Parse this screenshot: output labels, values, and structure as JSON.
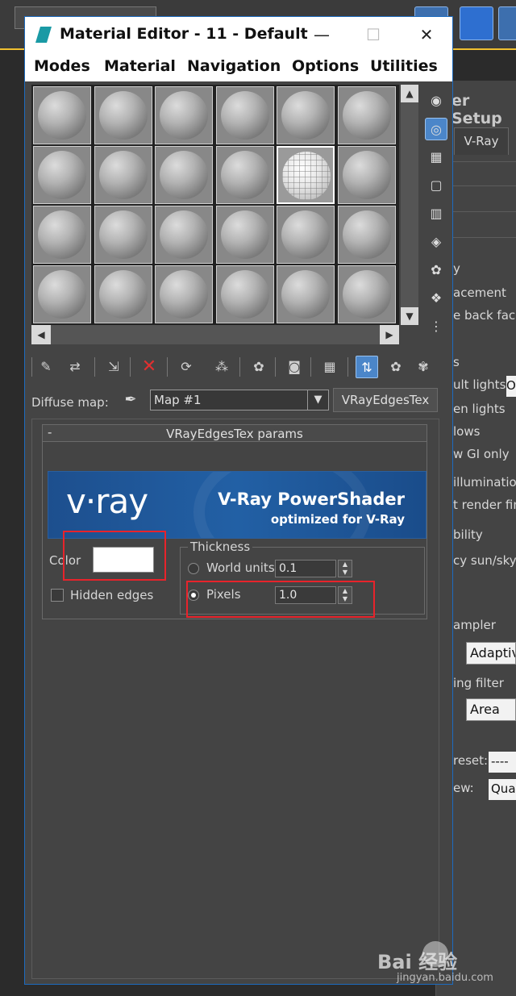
{
  "window": {
    "title": "Material Editor - 11 - Default",
    "controls": {
      "minimize": "—",
      "maximize": "☐",
      "close": "✕"
    }
  },
  "menu": [
    "Modes",
    "Material",
    "Navigation",
    "Options",
    "Utilities"
  ],
  "sample_slots": {
    "rows": 4,
    "cols": 6,
    "selected": {
      "row": 1,
      "col": 4
    }
  },
  "side_toolbar": [
    {
      "icon": "sample-type-icon",
      "glyph": "◉",
      "active": false
    },
    {
      "icon": "backlight-icon",
      "glyph": "◎",
      "active": true
    },
    {
      "icon": "background-checker-icon",
      "glyph": "▦",
      "active": false
    },
    {
      "icon": "sample-uv-tiling-icon",
      "glyph": "▢",
      "active": false
    },
    {
      "icon": "video-color-check-icon",
      "glyph": "▥",
      "active": false
    },
    {
      "icon": "make-preview-icon",
      "glyph": "◈",
      "active": false
    },
    {
      "icon": "material-options-icon",
      "glyph": "✿",
      "active": false
    },
    {
      "icon": "select-by-material-icon",
      "glyph": "❖",
      "active": false
    },
    {
      "icon": "material-map-navigator-icon",
      "glyph": "⋮",
      "active": false
    }
  ],
  "toolbar": [
    {
      "icon": "get-material-icon",
      "glyph": "✎"
    },
    {
      "icon": "put-material-icon",
      "glyph": "⇄"
    },
    {
      "icon": "assign-material-icon",
      "glyph": "⇲"
    },
    {
      "icon": "reset-map-icon",
      "glyph": "✕"
    },
    {
      "icon": "copy-material-icon",
      "glyph": "⟳"
    },
    {
      "icon": "make-unique-icon",
      "glyph": "⁂"
    },
    {
      "icon": "put-to-library-icon",
      "glyph": "✿"
    },
    {
      "icon": "material-id-channel-icon",
      "glyph": "◙"
    },
    {
      "icon": "show-shaded-material-icon",
      "glyph": "▦"
    },
    {
      "icon": "show-end-result-icon",
      "glyph": "⇅"
    },
    {
      "icon": "go-to-parent-icon",
      "glyph": "✿"
    },
    {
      "icon": "go-forward-to-sibling-icon",
      "glyph": "✾"
    }
  ],
  "map_row": {
    "label": "Diffuse map:",
    "map_name": "Map #1",
    "map_type": "VRayEdgesTex"
  },
  "rollout": {
    "toggle": "-",
    "title": "VRayEdgesTex params",
    "banner": {
      "logo": "v·ray",
      "headline": "V-Ray PowerShader",
      "sub": "optimized for V-Ray"
    },
    "color_label": "Color",
    "color_value": "#ffffff",
    "hidden_edges_label": "Hidden edges",
    "hidden_edges_checked": false,
    "thickness": {
      "title": "Thickness",
      "world_units_label": "World units",
      "world_units_value": "0.1",
      "pixels_label": "Pixels",
      "pixels_value": "1.0",
      "selected": "pixels"
    }
  },
  "background_panel": {
    "title": "er Setup",
    "tab": "V-Ray",
    "lines": [
      "y",
      "acement",
      "e back face",
      "s",
      "ult lights",
      "en lights",
      "lows",
      "w GI only",
      "illumination",
      "t render fin",
      "bility",
      "cy sun/sky/",
      "ampler",
      "ing filter",
      "reset:",
      "ew:"
    ],
    "dropdowns": [
      "Adaptive",
      "Area"
    ],
    "small_fields": [
      "O",
      "----",
      "Qua"
    ]
  },
  "watermark": {
    "text": "Bai 经验",
    "url": "jingyan.baidu.com"
  },
  "colors": {
    "highlight": "#e8232b",
    "accent": "#4b86c9",
    "panel": "#444444"
  }
}
